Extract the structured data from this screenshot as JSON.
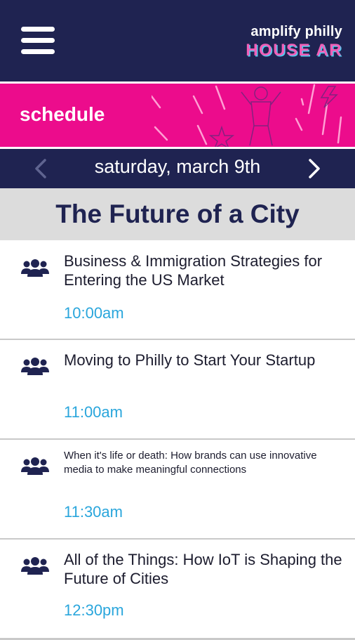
{
  "header": {
    "brand_line1": "amplify philly",
    "brand_line2": "HOUSE AR"
  },
  "banner": {
    "title": "schedule"
  },
  "date_nav": {
    "label": "saturday, march 9th"
  },
  "section": {
    "title": "The Future of a City"
  },
  "sessions": [
    {
      "title": "Business & Immigration Strategies for Entering the US Market",
      "time": "10:00am"
    },
    {
      "title": "Moving to Philly to Start Your Startup",
      "time": "11:00am"
    },
    {
      "title": "When it's life or death: How brands can use innovative media to make meaningful connections",
      "time": "11:30am"
    },
    {
      "title": "All of the Things: How IoT is Shaping the Future of Cities",
      "time": "12:30pm"
    }
  ],
  "colors": {
    "navy": "#1f2351",
    "magenta": "#ec0c8c",
    "time_blue": "#2aa6dc",
    "section_gray": "#dcdcdc"
  }
}
